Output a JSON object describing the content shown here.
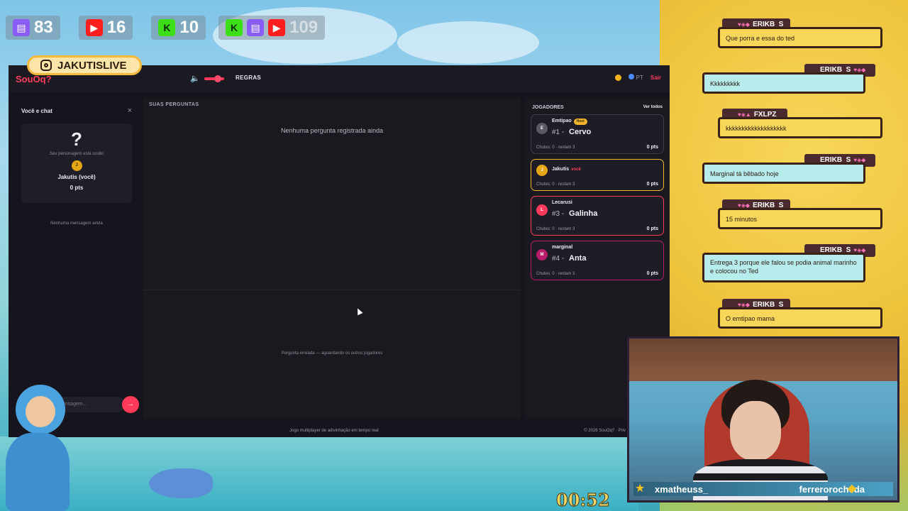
{
  "stream": {
    "stats": [
      {
        "icon": "twitch-icon",
        "value": "83"
      },
      {
        "icon": "youtube-icon",
        "value": "16"
      },
      {
        "icon": "kick-icon",
        "value": "10"
      },
      {
        "icon": "total-icon",
        "value": "109"
      }
    ],
    "instagram": "JAKUTISLIVE",
    "timer": "00:52",
    "cam_names": {
      "left": "xmatheuss_",
      "right": "ferrerorocheda"
    }
  },
  "app": {
    "logo": "SouOq?",
    "rules_label": "REGRAS",
    "language": "PT",
    "exit_label": "Sair",
    "left_panel": {
      "title": "Você e chat",
      "close_icon": "×",
      "card": {
        "mark": "?",
        "hidden_text": "Seu personagem está oculto",
        "avatar_letter": "J",
        "name": "Jakutis (você)",
        "points": "0 pts"
      },
      "no_messages": "Nenhuma mensagem ainda",
      "input_placeholder": "mensagem...",
      "send_icon": "→"
    },
    "middle_panel": {
      "title": "SUAS PERGUNTAS",
      "empty": "Nenhuma pergunta registrada ainda",
      "status": "Pergunta enviada — aguardando os outros jogadores"
    },
    "right_panel": {
      "title": "JOGADORES",
      "see_all": "Ver todos",
      "players": [
        {
          "avatar": "E",
          "color": "#5a5a66",
          "name": "Emtipao",
          "tag": "Host",
          "rank": "#1",
          "answer": "Cervo",
          "meta": "Chutes: 0 · restam 3",
          "score": "0 pts",
          "style": "normal"
        },
        {
          "avatar": "J",
          "color": "#e5a616",
          "name": "Jakutis",
          "you": "você",
          "rank": "",
          "answer": "",
          "meta": "Chutes: 0 · restam 3",
          "score": "0 pts",
          "style": "me"
        },
        {
          "avatar": "L",
          "color": "#ff3b5c",
          "name": "Lecarusi",
          "rank": "#3",
          "answer": "Galinha",
          "meta": "Chutes: 0 · restam 3",
          "score": "0 pts",
          "style": "red"
        },
        {
          "avatar": "M",
          "color": "#b91c6a",
          "name": "marginal",
          "rank": "#4",
          "answer": "Anta",
          "meta": "Chutes: 0 · restam 3",
          "score": "0 pts",
          "style": "mag"
        }
      ]
    },
    "footer": {
      "center": "Jogo multiplayer de adivinhação em tempo real",
      "right": "© 2026 SouOq? · Priv"
    }
  },
  "chat": [
    {
      "user": "ERIKB_S",
      "text": "Que porra e essa do ted",
      "side": "left",
      "color": "yellow"
    },
    {
      "user": "ERIKB_S",
      "text": "Kkkkkkkkk",
      "side": "right",
      "color": "cyan"
    },
    {
      "user": "FXLPZ_",
      "text": "kkkkkkkkkkkkkkkkkkk",
      "side": "left",
      "color": "yellow"
    },
    {
      "user": "ERIKB_S",
      "text": "Marginal tá bêbado hoje",
      "side": "right",
      "color": "cyan"
    },
    {
      "user": "ERIKB_S",
      "text": "15 minutos",
      "side": "left",
      "color": "yellow"
    },
    {
      "user": "ERIKB_S",
      "text": "Entrega 3 porque ele falou se podia animal marinho e colocou no Ted",
      "side": "right",
      "color": "cyan"
    },
    {
      "user": "ERIKB_S",
      "text": "O emtipao mama",
      "side": "left",
      "color": "yellow"
    }
  ]
}
